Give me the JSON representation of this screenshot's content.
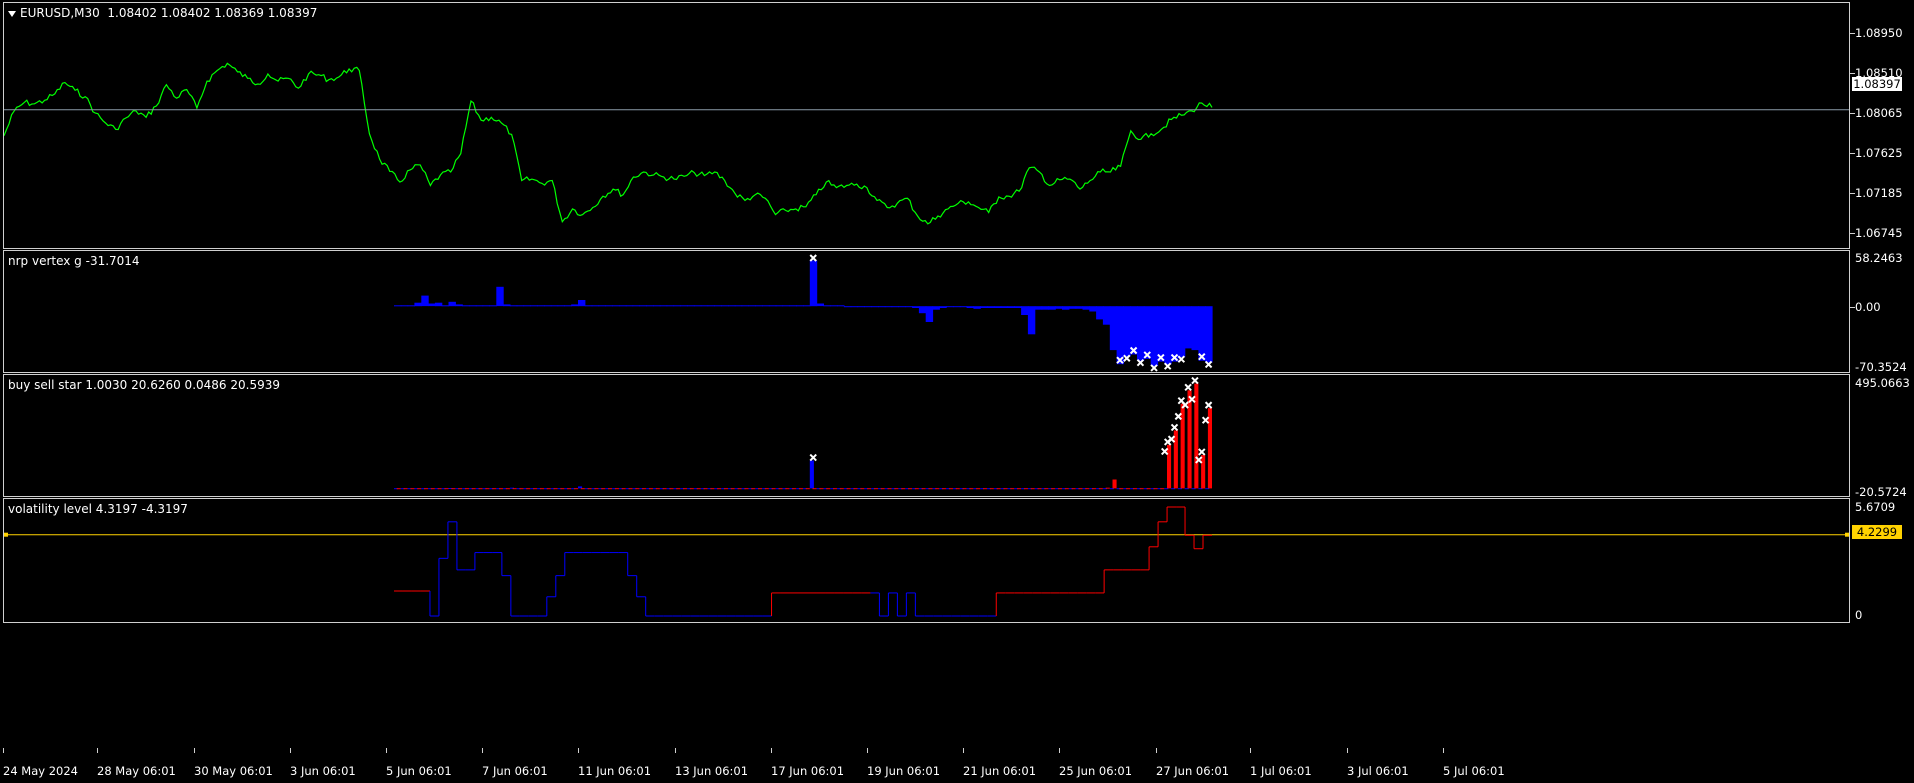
{
  "main_pane": {
    "symbol_label": "EURUSD,M30",
    "ohlc": "1.08402 1.08402 1.08369 1.08397",
    "y_labels": [
      "1.08950",
      "1.08510",
      "1.08065",
      "1.07625",
      "1.07185",
      "1.06745"
    ],
    "current_price": "1.08397",
    "line_color": "#00ff00"
  },
  "nrp_pane": {
    "title": "nrp vertex g -31.7014",
    "y_labels": [
      "58.2463",
      "0.00",
      "-70.3524"
    ],
    "color": "#0000ff"
  },
  "bss_pane": {
    "title": "buy sell star 1.0030 20.6260 0.0486 20.5939",
    "y_labels": [
      "495.0663",
      "-20.5724"
    ],
    "colors": [
      "#0000ff",
      "#ff0000"
    ]
  },
  "vol_pane": {
    "title": "volatility level 4.3197 -4.3197",
    "y_labels": [
      "5.6709",
      "0"
    ],
    "level_value": "4.2299",
    "level_color": "#ffd200"
  },
  "x_axis": {
    "labels": [
      "24 May 2024",
      "28 May 06:01",
      "30 May 06:01",
      "3 Jun 06:01",
      "5 Jun 06:01",
      "7 Jun 06:01",
      "11 Jun 06:01",
      "13 Jun 06:01",
      "17 Jun 06:01",
      "19 Jun 06:01",
      "21 Jun 06:01",
      "25 Jun 06:01",
      "27 Jun 06:01",
      "1 Jul 06:01",
      "3 Jul 06:01",
      "5 Jul 06:01"
    ]
  },
  "chart_data": [
    {
      "type": "line",
      "series": [
        {
          "name": "EURUSD,M30",
          "values": [
            1.0803,
            1.0838,
            1.085,
            1.0848,
            1.0853,
            1.0862,
            1.0878,
            1.0867,
            1.0858,
            1.0835,
            1.0821,
            1.0812,
            1.0828,
            1.0838,
            1.0829,
            1.0845,
            1.0875,
            1.0856,
            1.0868,
            1.0842,
            1.088,
            1.0895,
            1.0905,
            1.0893,
            1.0884,
            1.0876,
            1.089,
            1.088,
            1.0884,
            1.087,
            1.089,
            1.0889,
            1.0882,
            1.0886,
            1.0897,
            1.0895,
            1.0806,
            1.077,
            1.0753,
            1.0738,
            1.0755,
            1.0762,
            1.0733,
            1.0748,
            1.0752,
            1.0778,
            1.0852,
            1.0825,
            1.0829,
            1.0821,
            1.0805,
            1.074,
            1.0742,
            1.0736,
            1.074,
            1.0682,
            1.07,
            1.0692,
            1.0702,
            1.0718,
            1.0728,
            1.072,
            1.0745,
            1.0752,
            1.0748,
            1.0745,
            1.0742,
            1.0746,
            1.0751,
            1.0747,
            1.0752,
            1.074,
            1.0722,
            1.0712,
            1.072,
            1.0715,
            1.0692,
            1.0698,
            1.07,
            1.0703,
            1.072,
            1.0738,
            1.073,
            1.0733,
            1.0735,
            1.073,
            1.0712,
            1.0702,
            1.0708,
            1.0715,
            1.069,
            1.0679,
            1.069,
            1.07,
            1.0708,
            1.071,
            1.0702,
            1.0695,
            1.0717,
            1.0718,
            1.0725,
            1.0758,
            1.0752,
            1.0733,
            1.0741,
            1.0742,
            1.0728,
            1.074,
            1.0752,
            1.0752,
            1.076,
            1.081,
            1.0798,
            1.0806,
            1.0812,
            1.0826,
            1.0832,
            1.0838,
            1.0849,
            1.0843
          ]
        }
      ],
      "ylim": [
        1.0645,
        1.099
      ]
    },
    {
      "type": "bar",
      "series": [
        {
          "name": "nrp vertex g",
          "values": [
            1,
            1,
            1,
            4,
            12,
            3,
            4,
            1,
            5,
            2,
            1,
            1,
            1,
            1,
            1,
            22,
            2,
            1,
            1,
            1,
            1,
            1,
            1,
            1,
            1,
            1,
            2,
            7,
            1,
            1,
            1,
            1,
            1,
            1,
            1,
            1,
            1,
            1,
            1,
            1,
            1,
            1,
            1,
            1,
            1,
            1,
            1,
            1,
            1,
            1,
            1,
            1,
            1,
            1,
            1,
            1,
            1,
            1,
            1,
            1,
            1,
            52,
            3,
            1,
            1,
            1,
            0,
            0,
            0,
            0,
            0,
            0,
            0,
            0,
            0,
            0,
            -2,
            -8,
            -18,
            -4,
            -2,
            0,
            0,
            0,
            -2,
            -3,
            -2,
            -2,
            -2,
            -2,
            -2,
            -2,
            -10,
            -32,
            -4,
            -4,
            -4,
            -3,
            -4,
            -3,
            -3,
            -4,
            -6,
            -15,
            -21,
            -50,
            -66,
            -57,
            -55,
            -62,
            -60,
            -68,
            -63,
            -66,
            -63,
            -58,
            -48,
            -50,
            -62,
            -64
          ]
        }
      ],
      "ylim": [
        -70.3524,
        58.2463
      ]
    },
    {
      "type": "bar",
      "series": [
        {
          "name": "buy sell star (blue)",
          "values": [
            1,
            1,
            1,
            1,
            1,
            1,
            1,
            1,
            2,
            1,
            1,
            1,
            1,
            1,
            1,
            1,
            1,
            3,
            1,
            1,
            1,
            1,
            1,
            1,
            1,
            1,
            1,
            9,
            1,
            1,
            1,
            1,
            1,
            1,
            1,
            1,
            1,
            1,
            1,
            1,
            1,
            1,
            1,
            1,
            1,
            1,
            1,
            1,
            1,
            1,
            1,
            1,
            1,
            1,
            1,
            1,
            1,
            1,
            1,
            1,
            1,
            125,
            1,
            1,
            1,
            1,
            1,
            1,
            1,
            1,
            1,
            1,
            1,
            1,
            1,
            1,
            1,
            1,
            1,
            1,
            1,
            1,
            1,
            1,
            1,
            1,
            1,
            1,
            1,
            1,
            1,
            1,
            1,
            1,
            1,
            1,
            1,
            1,
            1,
            1,
            1,
            1,
            1,
            1,
            1,
            1,
            1,
            1,
            1,
            1,
            1,
            1,
            1,
            1,
            1,
            1,
            1,
            1,
            1,
            1
          ]
        },
        {
          "name": "buy sell star (red)",
          "values": [
            1,
            1,
            1,
            1,
            1,
            1,
            1,
            1,
            1,
            1,
            1,
            1,
            1,
            1,
            1,
            1,
            1,
            1,
            1,
            1,
            1,
            1,
            1,
            1,
            1,
            1,
            1,
            1,
            1,
            1,
            1,
            1,
            1,
            1,
            1,
            1,
            1,
            1,
            1,
            1,
            1,
            1,
            1,
            1,
            1,
            1,
            1,
            1,
            1,
            1,
            1,
            1,
            1,
            1,
            1,
            1,
            1,
            1,
            1,
            1,
            1,
            1,
            1,
            1,
            1,
            1,
            1,
            1,
            1,
            1,
            1,
            1,
            1,
            1,
            1,
            1,
            1,
            1,
            1,
            1,
            1,
            1,
            1,
            1,
            1,
            1,
            1,
            1,
            1,
            1,
            1,
            1,
            1,
            1,
            1,
            1,
            1,
            1,
            1,
            1,
            1,
            1,
            1,
            1,
            3,
            40,
            1,
            1,
            1,
            1,
            1,
            1,
            1,
            195,
            260,
            380,
            440,
            470,
            150,
            360
          ]
        }
      ],
      "ylim": [
        -20.5724,
        495.0663
      ]
    },
    {
      "type": "line",
      "series": [
        {
          "name": "volatility level",
          "values": [
            1.3,
            1.3,
            1.3,
            1.3,
            0,
            3.0,
            4.9,
            2.4,
            2.4,
            3.3,
            3.3,
            3.3,
            2.1,
            0,
            0,
            0,
            0,
            1.0,
            2.1,
            3.3,
            3.3,
            3.3,
            3.3,
            3.3,
            3.3,
            3.3,
            2.1,
            1.0,
            0,
            0,
            0,
            0,
            0,
            0,
            0,
            0,
            0,
            0,
            0,
            0,
            0,
            0,
            1.2,
            1.2,
            1.2,
            1.2,
            1.2,
            1.2,
            1.2,
            1.2,
            1.2,
            1.2,
            1.2,
            1.2,
            0,
            1.2,
            0,
            1.2,
            0,
            0,
            0,
            0,
            0,
            0,
            0,
            0,
            0,
            1.2,
            1.2,
            1.2,
            1.2,
            1.2,
            1.2,
            1.2,
            1.2,
            1.2,
            1.2,
            1.2,
            1.2,
            2.4,
            2.4,
            2.4,
            2.4,
            2.4,
            3.6,
            4.9,
            5.6709,
            5.6709,
            4.2,
            3.5,
            4.2
          ]
        }
      ],
      "ylim": [
        0,
        5.6709
      ],
      "level": 4.2299
    }
  ]
}
